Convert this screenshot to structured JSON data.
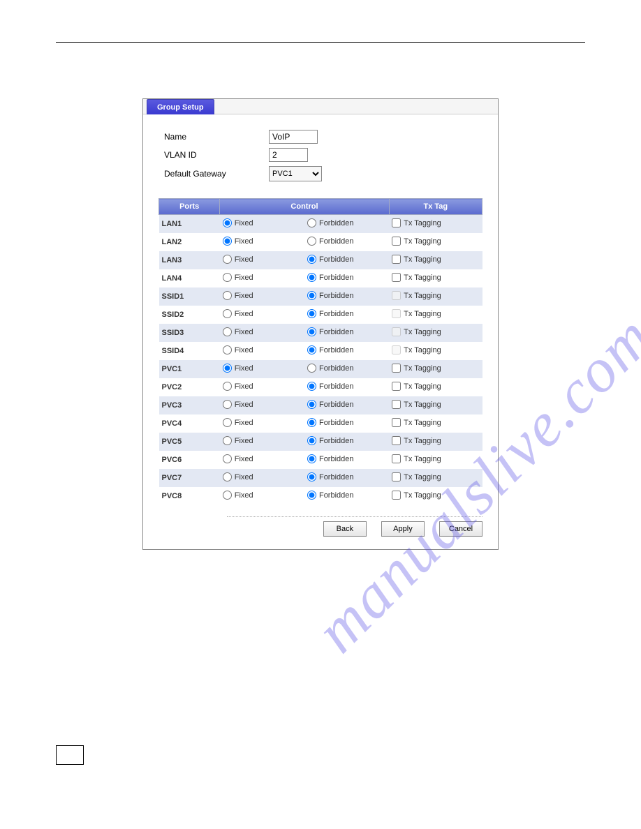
{
  "header": {
    "tab_label": "Group Setup"
  },
  "form": {
    "name_label": "Name",
    "name_value": "VoIP",
    "vlan_label": "VLAN ID",
    "vlan_value": "2",
    "gateway_label": "Default Gateway",
    "gateway_value": "PVC1"
  },
  "table": {
    "col_ports": "Ports",
    "col_control": "Control",
    "col_txtag": "Tx Tag",
    "fixed_label": "Fixed",
    "forbidden_label": "Forbidden",
    "txtag_label": "Tx Tagging",
    "rows": [
      {
        "port": "LAN1",
        "control": "fixed",
        "tx_disabled": false
      },
      {
        "port": "LAN2",
        "control": "fixed",
        "tx_disabled": false
      },
      {
        "port": "LAN3",
        "control": "forbidden",
        "tx_disabled": false
      },
      {
        "port": "LAN4",
        "control": "forbidden",
        "tx_disabled": false
      },
      {
        "port": "SSID1",
        "control": "forbidden",
        "tx_disabled": true
      },
      {
        "port": "SSID2",
        "control": "forbidden",
        "tx_disabled": true
      },
      {
        "port": "SSID3",
        "control": "forbidden",
        "tx_disabled": true
      },
      {
        "port": "SSID4",
        "control": "forbidden",
        "tx_disabled": true
      },
      {
        "port": "PVC1",
        "control": "fixed",
        "tx_disabled": false
      },
      {
        "port": "PVC2",
        "control": "forbidden",
        "tx_disabled": false
      },
      {
        "port": "PVC3",
        "control": "forbidden",
        "tx_disabled": false
      },
      {
        "port": "PVC4",
        "control": "forbidden",
        "tx_disabled": false
      },
      {
        "port": "PVC5",
        "control": "forbidden",
        "tx_disabled": false
      },
      {
        "port": "PVC6",
        "control": "forbidden",
        "tx_disabled": false
      },
      {
        "port": "PVC7",
        "control": "forbidden",
        "tx_disabled": false
      },
      {
        "port": "PVC8",
        "control": "forbidden",
        "tx_disabled": false
      }
    ]
  },
  "buttons": {
    "back": "Back",
    "apply": "Apply",
    "cancel": "Cancel"
  },
  "watermark": "manualslive.com"
}
